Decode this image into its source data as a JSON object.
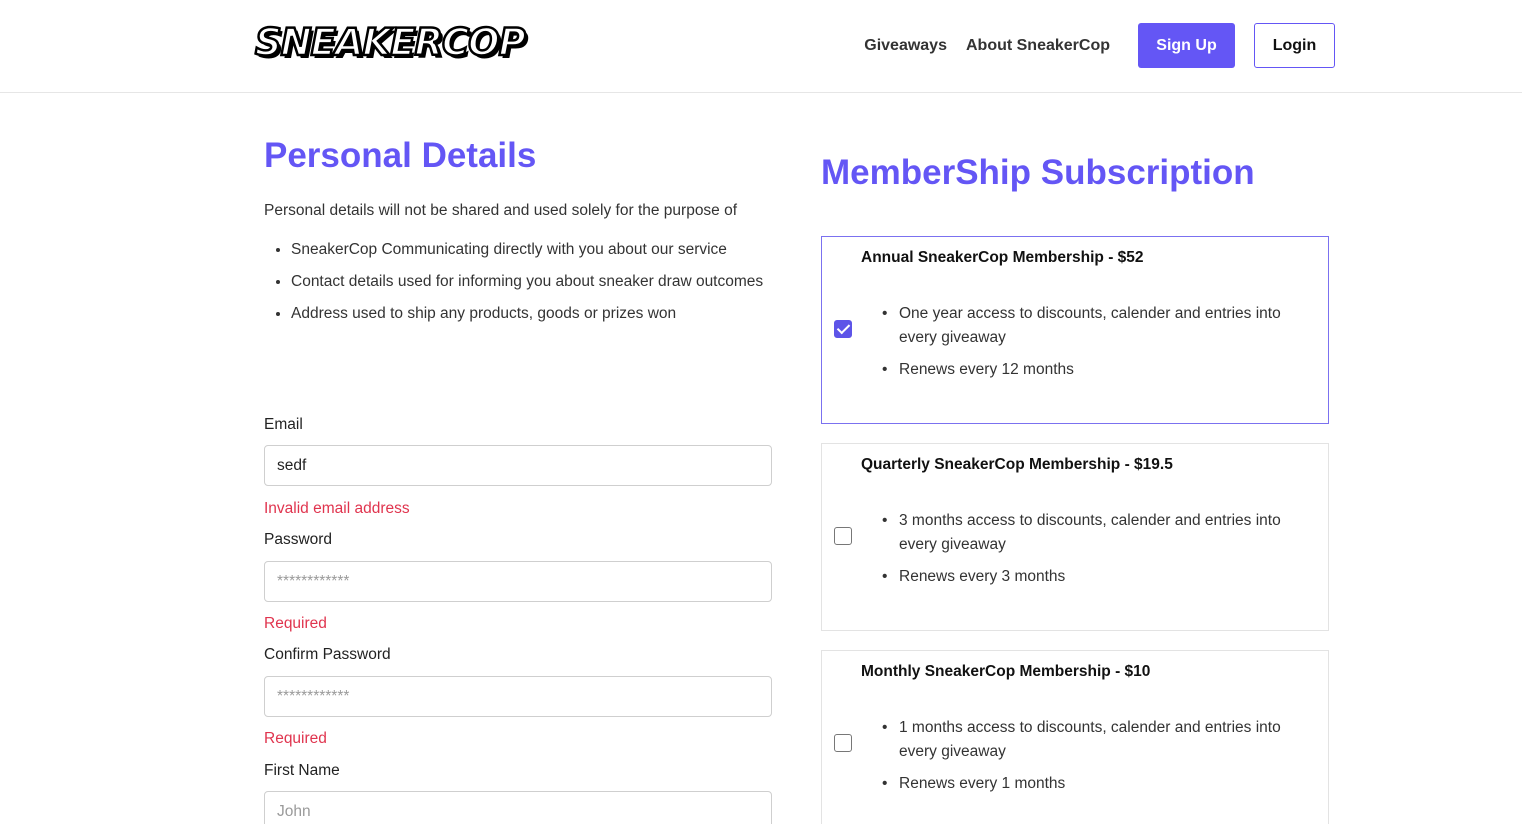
{
  "header": {
    "logo_text": "SNEAKERCOP",
    "nav": {
      "giveaways": "Giveaways",
      "about": "About SneakerCop",
      "signup": "Sign Up",
      "login": "Login"
    }
  },
  "personal": {
    "title": "Personal Details",
    "intro": "Personal details will not be shared and used solely for the purpose of",
    "bullets": [
      "SneakerCop Communicating directly with you about our service",
      "Contact details used for informing you about sneaker draw outcomes",
      "Address used to ship any products, goods or prizes won"
    ],
    "fields": {
      "email": {
        "label": "Email",
        "value": "sedf",
        "error": "Invalid email address"
      },
      "password": {
        "label": "Password",
        "placeholder": "************",
        "error": "Required"
      },
      "confirm_password": {
        "label": "Confirm Password",
        "placeholder": "************",
        "error": "Required"
      },
      "first_name": {
        "label": "First Name",
        "placeholder": "John"
      }
    }
  },
  "membership": {
    "title": "MemberShip Subscription",
    "plans": [
      {
        "title": "Annual SneakerCop Membership - $52",
        "checked": true,
        "features": [
          "One year access to discounts, calender and entries into every giveaway",
          "Renews every 12 months"
        ]
      },
      {
        "title": "Quarterly SneakerCop Membership - $19.5",
        "checked": false,
        "features": [
          "3 months access to discounts, calender and entries into every giveaway",
          "Renews every 3 months"
        ]
      },
      {
        "title": "Monthly SneakerCop Membership - $10",
        "checked": false,
        "features": [
          "1 months access to discounts, calender and entries into every giveaway",
          "Renews every 1 months"
        ]
      }
    ]
  },
  "colors": {
    "accent": "#6456f5",
    "error": "#e0344e",
    "checkbox_checked": "#5d54e8"
  }
}
